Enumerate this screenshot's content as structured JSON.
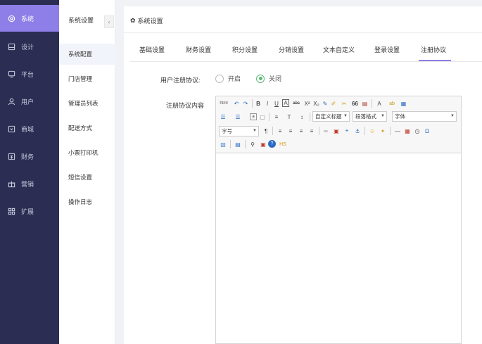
{
  "nav": {
    "items": [
      {
        "label": "系统",
        "icon": "gear-icon"
      },
      {
        "label": "设计",
        "icon": "layout-icon"
      },
      {
        "label": "平台",
        "icon": "monitor-icon"
      },
      {
        "label": "用户",
        "icon": "user-icon"
      },
      {
        "label": "商城",
        "icon": "shop-icon"
      },
      {
        "label": "财务",
        "icon": "wallet-icon"
      },
      {
        "label": "营销",
        "icon": "gift-icon"
      },
      {
        "label": "扩展",
        "icon": "grid-icon"
      }
    ]
  },
  "subnav": {
    "header": "系统设置",
    "collapse_label": "‹",
    "items": [
      "系统配置",
      "门店管理",
      "管理员列表",
      "配送方式",
      "小票打印机",
      "短信设置",
      "操作日志"
    ]
  },
  "panel": {
    "title": "系统设置",
    "tabs": [
      "基础设置",
      "财务设置",
      "积分设置",
      "分销设置",
      "文本自定义",
      "登录设置",
      "注册协议"
    ],
    "active_tab": "注册协议",
    "agreement_label": "用户注册协议:",
    "radio_on": "开启",
    "radio_off": "关闭",
    "radio_selected": "关闭",
    "content_label": "注册协议内容"
  },
  "editor": {
    "row1": [
      "html",
      "↶",
      "↷",
      "B",
      "I",
      "U",
      "A",
      "abc",
      "X²",
      "X₂",
      "✎",
      "✐",
      "✂",
      "66",
      "▤",
      "A",
      "ab",
      "▦"
    ],
    "select_custom_title": "自定义标题",
    "select_paragraph": "段落格式",
    "select_font": "字体",
    "select_size": "字号",
    "row2": [
      "☰",
      "☰",
      "a",
      "▢",
      "≡",
      "T",
      "↕"
    ],
    "row3": [
      "¶",
      "≡",
      "≡",
      "≡",
      "≡",
      "∞",
      "▣",
      "⌖",
      "⚓",
      "☺",
      "✦",
      "—",
      "▦",
      "◷",
      "Ω"
    ],
    "row4": [
      "▧",
      "▤",
      "⚲",
      "▣",
      "?",
      "HS"
    ]
  }
}
